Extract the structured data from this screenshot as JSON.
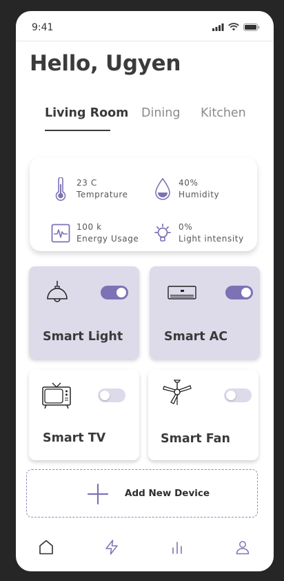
{
  "status_bar": {
    "time": "9:41"
  },
  "greeting": "Hello, Ugyen",
  "tabs": [
    {
      "label": "Living  Room",
      "active": true
    },
    {
      "label": "Dining",
      "active": false
    },
    {
      "label": "Kitchen",
      "active": false
    }
  ],
  "stats": [
    {
      "value": "23 C",
      "label": "Temprature",
      "icon": "thermometer-icon"
    },
    {
      "value": "40%",
      "label": "Humidity",
      "icon": "water-drop-icon"
    },
    {
      "value": "100 k",
      "label": "Energy Usage",
      "icon": "energy-pulse-icon"
    },
    {
      "value": "0%",
      "label": "Light intensity",
      "icon": "lightbulb-icon"
    }
  ],
  "devices": [
    {
      "name": "Smart Light",
      "on": true,
      "icon": "pendant-lamp-icon"
    },
    {
      "name": "Smart AC",
      "on": true,
      "icon": "air-conditioner-icon"
    },
    {
      "name": "Smart TV",
      "on": false,
      "icon": "tv-icon"
    },
    {
      "name": "Smart Fan",
      "on": false,
      "icon": "ceiling-fan-icon"
    }
  ],
  "add_device_label": "Add New Device",
  "bottom_nav": [
    {
      "name": "home",
      "icon": "home-icon",
      "active": true
    },
    {
      "name": "energy",
      "icon": "lightning-icon",
      "active": false
    },
    {
      "name": "stats",
      "icon": "bar-chart-icon",
      "active": false
    },
    {
      "name": "profile",
      "icon": "user-icon",
      "active": false
    }
  ],
  "colors": {
    "accent": "#7d72b5",
    "card_on": "#dddaea",
    "background": "#262626"
  }
}
